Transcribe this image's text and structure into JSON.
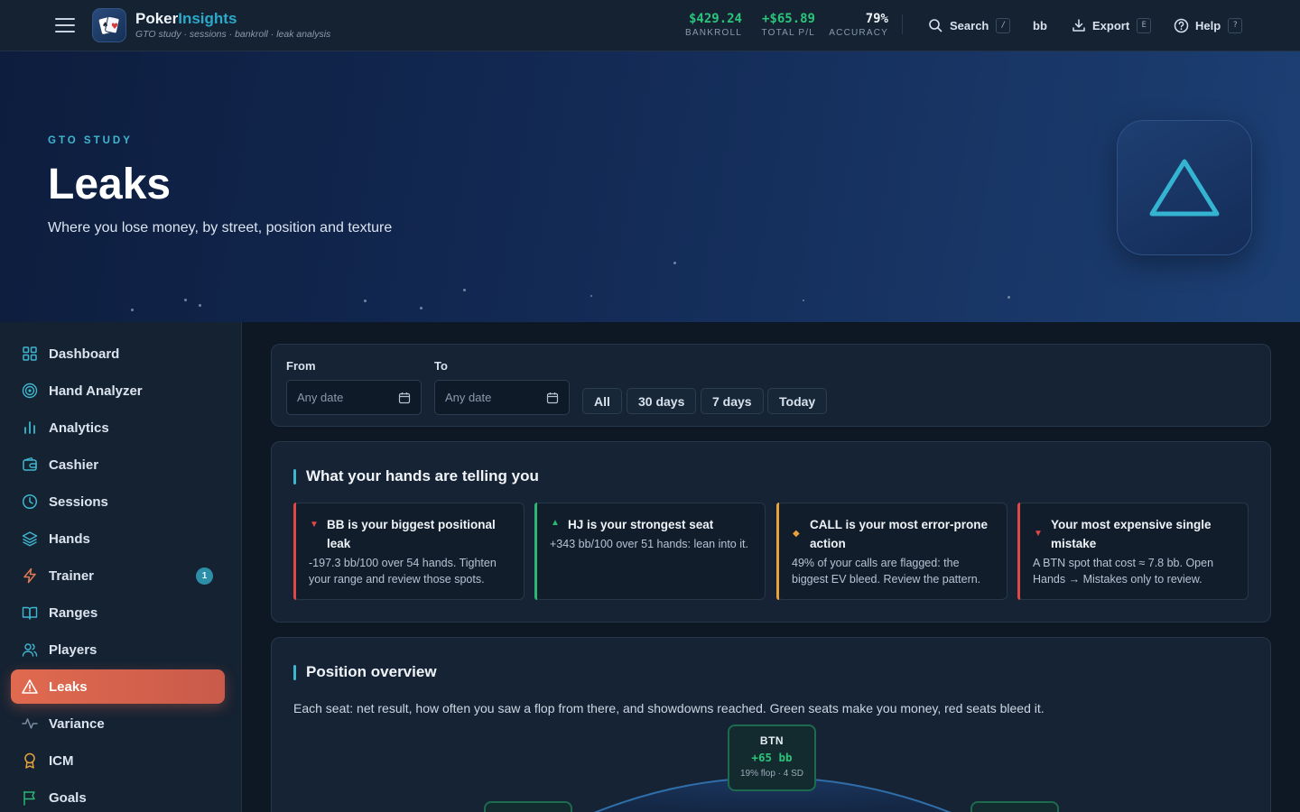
{
  "topbar": {
    "brand_part1": "Poker",
    "brand_part2": "Insights",
    "tagline": "GTO study · sessions · bankroll · leak analysis",
    "stats": [
      {
        "value": "$429.24",
        "label": "BANKROLL",
        "color": "#2bc47a"
      },
      {
        "value": "+$65.89",
        "label": "TOTAL P/L",
        "color": "#2bc47a"
      },
      {
        "value": "79%",
        "label": "ACCURACY",
        "color": "#eef3f8"
      }
    ],
    "search_label": "Search",
    "search_key": "/",
    "unit_label": "bb",
    "export_label": "Export",
    "export_key": "E",
    "help_label": "Help",
    "help_key": "?"
  },
  "hero": {
    "eyebrow": "GTO STUDY",
    "title": "Leaks",
    "subtitle": "Where you lose money, by street, position and texture",
    "icon": "warning-triangle-icon"
  },
  "sidebar": {
    "items": [
      {
        "label": "Dashboard",
        "icon": "grid-icon"
      },
      {
        "label": "Hand Analyzer",
        "icon": "target-icon"
      },
      {
        "label": "Analytics",
        "icon": "bar-chart-icon"
      },
      {
        "label": "Cashier",
        "icon": "wallet-icon"
      },
      {
        "label": "Sessions",
        "icon": "clock-icon"
      },
      {
        "label": "Hands",
        "icon": "layers-icon"
      },
      {
        "label": "Trainer",
        "icon": "lightning-icon",
        "badge": "1"
      },
      {
        "label": "Ranges",
        "icon": "book-icon"
      },
      {
        "label": "Players",
        "icon": "users-icon"
      },
      {
        "label": "Leaks",
        "icon": "warning-icon",
        "active": true
      },
      {
        "label": "Variance",
        "icon": "pulse-icon"
      },
      {
        "label": "ICM",
        "icon": "award-icon"
      },
      {
        "label": "Goals",
        "icon": "flag-icon"
      }
    ]
  },
  "filters": {
    "from_label": "From",
    "to_label": "To",
    "from_placeholder": "Any date",
    "to_placeholder": "Any date",
    "ranges": [
      "All",
      "30 days",
      "7 days",
      "Today"
    ]
  },
  "insights": {
    "title": "What your hands are telling you",
    "cards": [
      {
        "head": "BB is your biggest positional leak",
        "body": "-197.3 bb/100 over 54 hands. Tighten your range and review those spots.",
        "mark": "▼",
        "color": "#e04848"
      },
      {
        "head": "HJ is your strongest seat",
        "body": "+343 bb/100 over 51 hands: lean into it.",
        "mark": "▲",
        "color": "#2bb673"
      },
      {
        "head": "CALL is your most error-prone action",
        "body": "49% of your calls are flagged: the biggest EV bleed. Review the pattern.",
        "mark": "◆",
        "color": "#e8a23a"
      },
      {
        "head": "Your most expensive single mistake",
        "body": "A BTN spot that cost ≈ 7.8 bb. Open Hands → Mistakes only to review.",
        "mark": "▼",
        "color": "#e04848"
      }
    ]
  },
  "positions": {
    "title": "Position overview",
    "description": "Each seat: net result, how often you saw a flop from there, and showdowns reached. Green seats make you money, red seats bleed it.",
    "btn": {
      "name": "BTN",
      "value": "+65 bb",
      "stats": "19% flop · 4 SD"
    }
  }
}
